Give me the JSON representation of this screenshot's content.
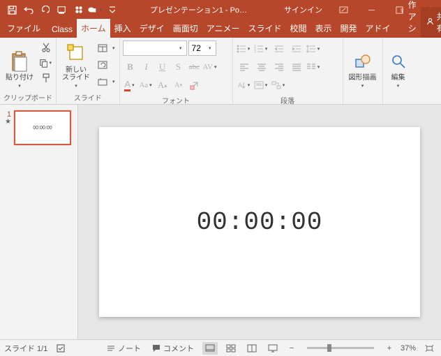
{
  "title": "プレゼンテーション1 - Po…",
  "signin": "サインイン",
  "tabs": {
    "file": "ファイル",
    "class": "Class",
    "home": "ホーム",
    "insert": "挿入",
    "design": "デザイ",
    "transitions": "画面切",
    "animations": "アニメー",
    "slideshow": "スライド",
    "review": "校閲",
    "view": "表示",
    "developer": "開発",
    "addins": "アドイ",
    "tellme": "操作アシ",
    "share": "共有"
  },
  "ribbon": {
    "clipboard": {
      "label": "クリップボード",
      "paste": "貼り付け"
    },
    "slides": {
      "label": "スライド",
      "newslide": "新しい\nスライド"
    },
    "font": {
      "label": "フォント",
      "name": "",
      "size": "72"
    },
    "paragraph": {
      "label": "段落"
    },
    "drawing": {
      "label": "図形描画"
    },
    "editing": {
      "label": "編集"
    }
  },
  "thumb": {
    "num": "1",
    "star": "★",
    "text": "00:00:00"
  },
  "slide": {
    "text": "00:00:00"
  },
  "status": {
    "slide": "スライド 1/1",
    "notes": "ノート",
    "comments": "コメント",
    "zoom": "37%"
  }
}
